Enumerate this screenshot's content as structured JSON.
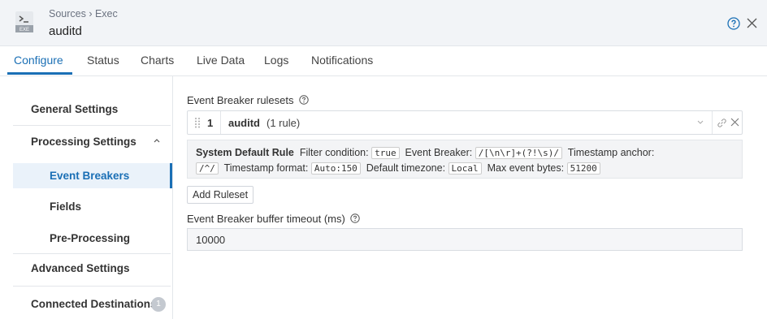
{
  "header": {
    "breadcrumb": "Sources › Exec",
    "title": "auditd",
    "icon_badge": "EXE"
  },
  "tabs": [
    {
      "label": "Configure",
      "active": true
    },
    {
      "label": "Status"
    },
    {
      "label": "Charts"
    },
    {
      "label": "Live Data"
    },
    {
      "label": "Logs"
    },
    {
      "label": "Notifications"
    }
  ],
  "sidebar": {
    "general": "General Settings",
    "processing": "Processing Settings",
    "event_breakers": "Event Breakers",
    "fields": "Fields",
    "pre_processing": "Pre-Processing",
    "advanced": "Advanced Settings",
    "connected": "Connected Destinations",
    "connected_count": "1"
  },
  "main": {
    "rulesets_label": "Event Breaker rulesets",
    "ruleset": {
      "number": "1",
      "name": "auditd",
      "count": "(1 rule)"
    },
    "rule": {
      "name": "System Default Rule",
      "filter_label": "Filter condition:",
      "filter_value": "true",
      "breaker_label": "Event Breaker:",
      "breaker_value": "/[\\n\\r]+(?!\\s)/",
      "ts_anchor_label": "Timestamp anchor:",
      "ts_anchor_value": "/^/",
      "ts_format_label": "Timestamp format:",
      "ts_format_value": "Auto:150",
      "tz_label": "Default timezone:",
      "tz_value": "Local",
      "max_bytes_label": "Max event bytes:",
      "max_bytes_value": "51200"
    },
    "add_ruleset": "Add Ruleset",
    "timeout_label": "Event Breaker buffer timeout (ms)",
    "timeout_value": "10000"
  },
  "colors": {
    "accent": "#1a6fb5",
    "header_bg": "#f2f4f7"
  }
}
